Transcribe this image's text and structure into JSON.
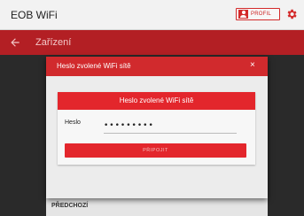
{
  "app": {
    "title": "EOB WiFi"
  },
  "header": {
    "profile_label": "PROFIL",
    "profile_icon": "user-icon",
    "settings_icon": "gear-icon"
  },
  "toolbar": {
    "back_icon": "arrow-left-icon",
    "title": "Zařízení"
  },
  "dialog": {
    "title": "Heslo zvolené WiFi sítě",
    "close": "×",
    "card_title": "Heslo zvolené WiFi sítě",
    "field_label": "Heslo",
    "password_value": "•••••••••",
    "connect_label": "PŘIPOJIT"
  },
  "footer": {
    "previous_label": "PŘEDCHOZÍ"
  },
  "colors": {
    "accent": "#d12a2d",
    "toolbar": "#b31f24",
    "overlay": "#2a2a2a"
  }
}
